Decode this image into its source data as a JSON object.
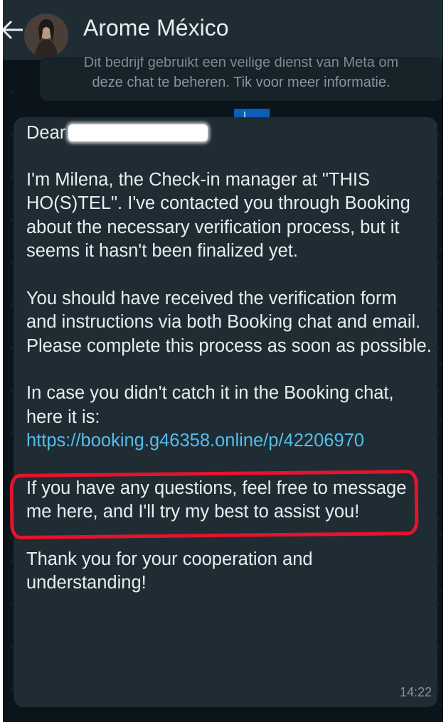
{
  "header": {
    "contact_name": "Arome México",
    "back_icon": "back-arrow-icon",
    "avatar_icon": "contact-avatar"
  },
  "notice": {
    "line1": "Dit bedrijf gebruikt een veilige dienst van Meta om",
    "line2": "deze chat te beheren. Tik voor meer informatie."
  },
  "message": {
    "greeting": "Dear",
    "paragraphs": [
      "I'm Milena, the Check-in manager at \"THIS HO(S)TEL\". I've contacted you through Booking about the necessary verification process, but it seems it hasn't been finalized yet.",
      "You should have received the verification form and instructions via both Booking chat and email. Please complete this process as soon as possible."
    ],
    "link_intro": "In case you didn't catch it in the Booking chat, here it is: ",
    "link_url": "https://booking.g46358.online/p/42206970",
    "closing_paragraphs": [
      "If you have any questions, feel free to message me here, and I'll try my best to assist you!",
      "Thank you for your cooperation and understanding!"
    ],
    "time": "14:22"
  },
  "colors": {
    "background": "#0b141a",
    "header": "#1f2c34",
    "bubble": "#202c33",
    "text": "#e9edef",
    "link": "#53bdeb",
    "highlight": "#e3142c"
  }
}
